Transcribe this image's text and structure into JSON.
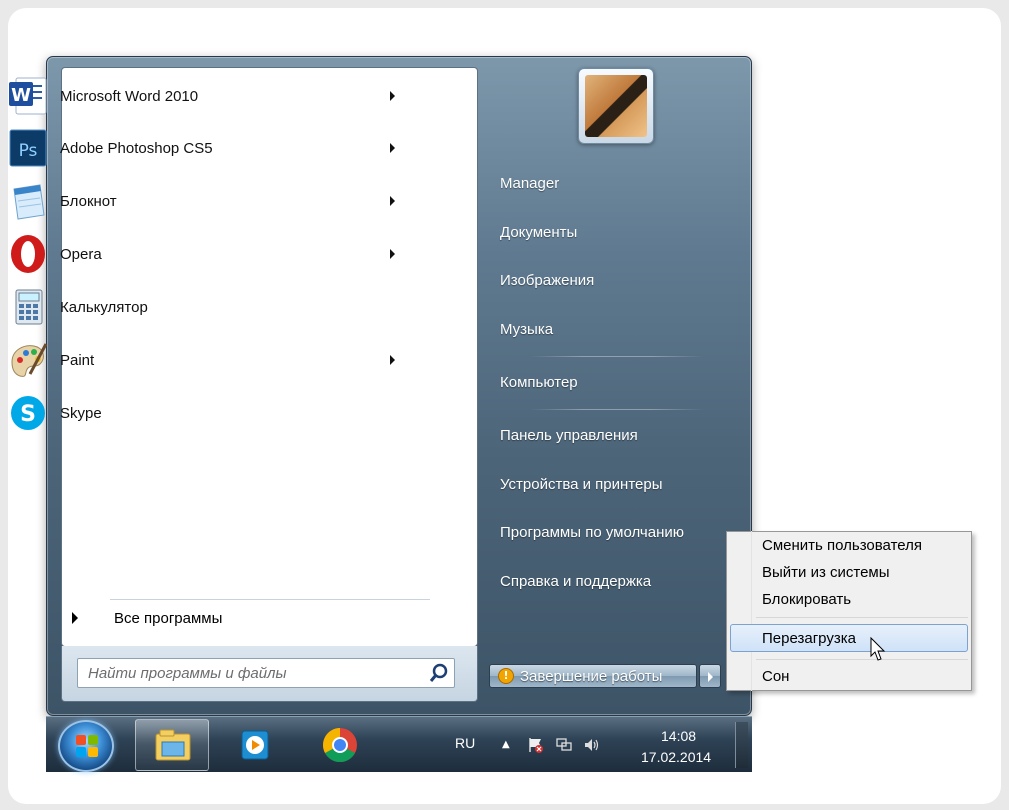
{
  "left_pane": {
    "programs": [
      {
        "label": "Microsoft Word 2010",
        "icon": "word-icon",
        "submenu": true
      },
      {
        "label": "Adobe Photoshop CS5",
        "icon": "photoshop-icon",
        "submenu": true
      },
      {
        "label": "Блокнот",
        "icon": "notepad-icon",
        "submenu": true
      },
      {
        "label": "Opera",
        "icon": "opera-icon",
        "submenu": true
      },
      {
        "label": "Калькулятор",
        "icon": "calculator-icon",
        "submenu": false
      },
      {
        "label": "Paint",
        "icon": "paint-icon",
        "submenu": true
      },
      {
        "label": "Skype",
        "icon": "skype-icon",
        "submenu": false
      }
    ],
    "all_programs": "Все программы",
    "search_placeholder": "Найти программы и файлы"
  },
  "right_pane": {
    "items": [
      "Manager",
      "Документы",
      "Изображения",
      "Музыка",
      "Компьютер",
      "Панель управления",
      "Устройства и принтеры",
      "Программы по умолчанию",
      "Справка и поддержка"
    ],
    "shutdown_label": "Завершение работы"
  },
  "context_menu": {
    "items": [
      "Сменить пользователя",
      "Выйти из системы",
      "Блокировать",
      "Перезагрузка",
      "Сон"
    ],
    "highlighted": "Перезагрузка"
  },
  "taskbar": {
    "language": "RU",
    "time": "14:08",
    "date": "17.02.2014",
    "pinned": [
      "explorer-icon",
      "media-player-icon",
      "chrome-icon"
    ]
  },
  "colors": {
    "menu_frame": "#5f7a90",
    "highlight_border": "#7da2ce",
    "taskbar": "#1d2d3c"
  }
}
